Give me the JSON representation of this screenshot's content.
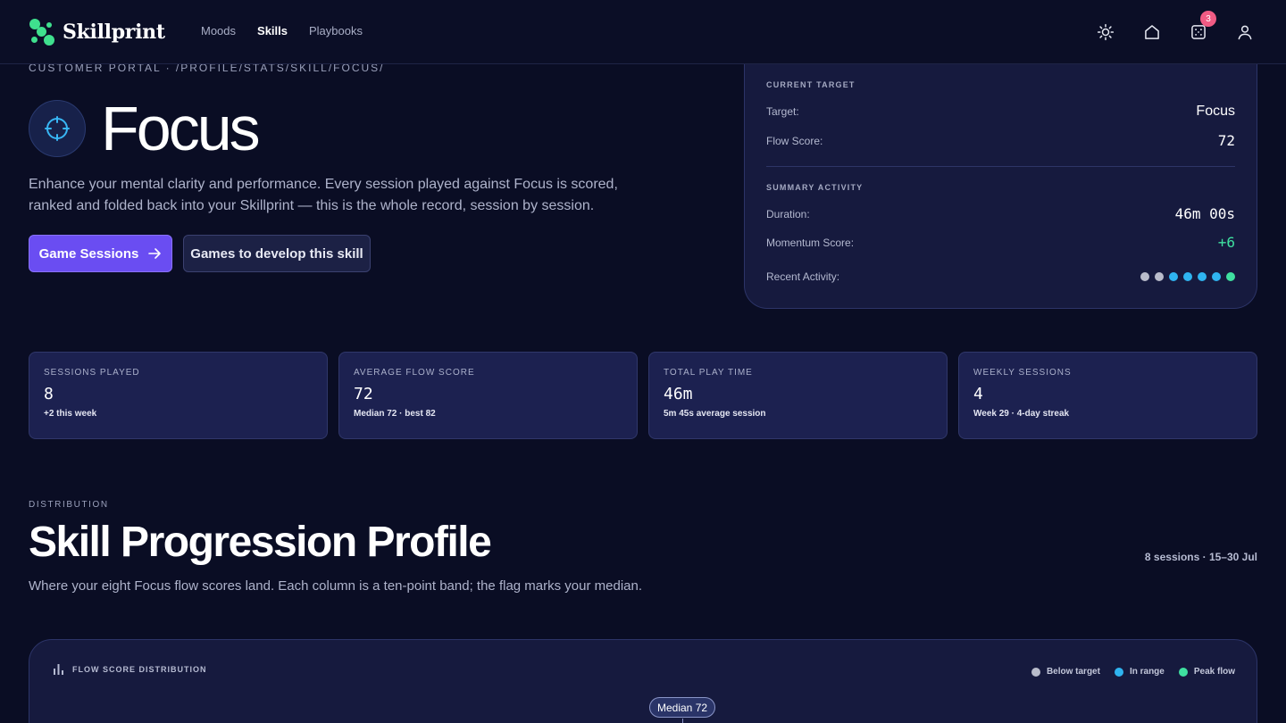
{
  "header": {
    "brand": "Skillprint",
    "nav": [
      "Moods",
      "Skills",
      "Playbooks"
    ],
    "active_nav": "Skills",
    "notifications_count": "3",
    "icons": [
      "sun-icon",
      "home-icon",
      "dice-icon",
      "user-icon"
    ]
  },
  "hero": {
    "breadcrumb": "CUSTOMER PORTAL · /PROFILE/STATS/SKILL/FOCUS/",
    "title": "Focus",
    "description": "Enhance your mental clarity and performance. Every session played against Focus is scored, ranked and folded back into your Skillprint — this is the whole record, session by session.",
    "primary_button": "Game Sessions",
    "secondary_button": "Games to develop this skill"
  },
  "target_card": {
    "current_target_heading": "CURRENT TARGET",
    "target_label": "Target:",
    "target_value": "Focus",
    "flow_label": "Flow Score:",
    "flow_value": "72",
    "summary_heading": "SUMMARY ACTIVITY",
    "duration_label": "Duration:",
    "duration_value": "46m 00s",
    "momentum_label": "Momentum Score:",
    "momentum_value": "+6",
    "recent_label": "Recent Activity:",
    "recent_dots": [
      "below",
      "below",
      "in-range",
      "in-range",
      "in-range",
      "in-range",
      "peak"
    ]
  },
  "stats": [
    {
      "label": "SESSIONS PLAYED",
      "value": "8",
      "sub": "+2 this week"
    },
    {
      "label": "AVERAGE FLOW SCORE",
      "value": "72",
      "sub": "Median 72 · best 82"
    },
    {
      "label": "TOTAL PLAY TIME",
      "value": "46m",
      "sub": "5m 45s average session"
    },
    {
      "label": "WEEKLY SESSIONS",
      "value": "4",
      "sub": "Week 29 · 4-day streak"
    }
  ],
  "distribution": {
    "eyebrow": "DISTRIBUTION",
    "title": "Skill Progression Profile",
    "meta": "8 sessions · 15–30 Jul",
    "description": "Where your eight Focus flow scores land. Each column is a ten-point band; the flag marks your median.",
    "chart_label": "FLOW SCORE DISTRIBUTION",
    "legend": [
      {
        "label": "Below target",
        "color": "#b9bccb"
      },
      {
        "label": "In range",
        "color": "#2fb4f0"
      },
      {
        "label": "Peak flow",
        "color": "#3fe0a0"
      }
    ],
    "median_flag": "Median 72"
  },
  "colors": {
    "accent": "#6a4df2",
    "brand_green": "#3fe08e",
    "momentum_positive": "#3fe0a0",
    "below": "#b9bccb",
    "in_range": "#2fb4f0",
    "peak": "#3fe0a0"
  }
}
